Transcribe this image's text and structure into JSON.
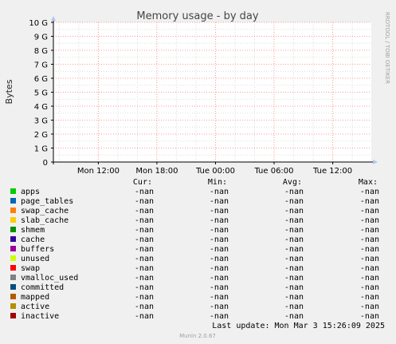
{
  "chart_data": {
    "type": "line",
    "title": "Memory usage - by day",
    "ylabel": "Bytes",
    "ylim": [
      0,
      10
    ],
    "y_unit": "G",
    "yticks": [
      0,
      1,
      2,
      3,
      4,
      5,
      6,
      7,
      8,
      9,
      10
    ],
    "ytick_labels": [
      "0",
      "1 G",
      "2 G",
      "3 G",
      "4 G",
      "5 G",
      "6 G",
      "7 G",
      "8 G",
      "9 G",
      "10 G"
    ],
    "x_tick_labels": [
      "Mon 12:00",
      "Mon 18:00",
      "Tue 00:00",
      "Tue 06:00",
      "Tue 12:00"
    ],
    "x_tick_hours": [
      12,
      18,
      24,
      30,
      36
    ],
    "x_range_hours": [
      7.4,
      39.95
    ],
    "minor_x_step_hours": 2,
    "minor_y_step": 0.5,
    "grid": true,
    "legend_headers": [
      "Cur:",
      "Min:",
      "Avg:",
      "Max:"
    ],
    "series": [
      {
        "name": "apps",
        "color": "#00cc00",
        "cur": "-nan",
        "min": "-nan",
        "avg": "-nan",
        "max": "-nan"
      },
      {
        "name": "page_tables",
        "color": "#0066b3",
        "cur": "-nan",
        "min": "-nan",
        "avg": "-nan",
        "max": "-nan"
      },
      {
        "name": "swap_cache",
        "color": "#ff8000",
        "cur": "-nan",
        "min": "-nan",
        "avg": "-nan",
        "max": "-nan"
      },
      {
        "name": "slab_cache",
        "color": "#ffcc00",
        "cur": "-nan",
        "min": "-nan",
        "avg": "-nan",
        "max": "-nan"
      },
      {
        "name": "shmem",
        "color": "#008f00",
        "cur": "-nan",
        "min": "-nan",
        "avg": "-nan",
        "max": "-nan"
      },
      {
        "name": "cache",
        "color": "#330099",
        "cur": "-nan",
        "min": "-nan",
        "avg": "-nan",
        "max": "-nan"
      },
      {
        "name": "buffers",
        "color": "#990099",
        "cur": "-nan",
        "min": "-nan",
        "avg": "-nan",
        "max": "-nan"
      },
      {
        "name": "unused",
        "color": "#ccff00",
        "cur": "-nan",
        "min": "-nan",
        "avg": "-nan",
        "max": "-nan"
      },
      {
        "name": "swap",
        "color": "#ff0000",
        "cur": "-nan",
        "min": "-nan",
        "avg": "-nan",
        "max": "-nan"
      },
      {
        "name": "vmalloc_used",
        "color": "#808080",
        "cur": "-nan",
        "min": "-nan",
        "avg": "-nan",
        "max": "-nan"
      },
      {
        "name": "committed",
        "color": "#004d80",
        "cur": "-nan",
        "min": "-nan",
        "avg": "-nan",
        "max": "-nan"
      },
      {
        "name": "mapped",
        "color": "#b35a00",
        "cur": "-nan",
        "min": "-nan",
        "avg": "-nan",
        "max": "-nan"
      },
      {
        "name": "active",
        "color": "#b38f00",
        "cur": "-nan",
        "min": "-nan",
        "avg": "-nan",
        "max": "-nan"
      },
      {
        "name": "inactive",
        "color": "#a00000",
        "cur": "-nan",
        "min": "-nan",
        "avg": "-nan",
        "max": "-nan"
      }
    ],
    "last_update": "Last update: Mon Mar  3 15:26:09 2025",
    "watermark": "RRDTOOL / TOBI OETIKER",
    "footer": "Munin 2.0.67"
  },
  "colors": {
    "background": "#f0f0f0",
    "plot_background": "#ffffff",
    "major_grid": "#ff9999",
    "minor_grid": "#dddddd",
    "axis": "#000000",
    "arrow": "#b0c8f0",
    "text": "#000000",
    "muted_text": "#a0a0a0"
  }
}
